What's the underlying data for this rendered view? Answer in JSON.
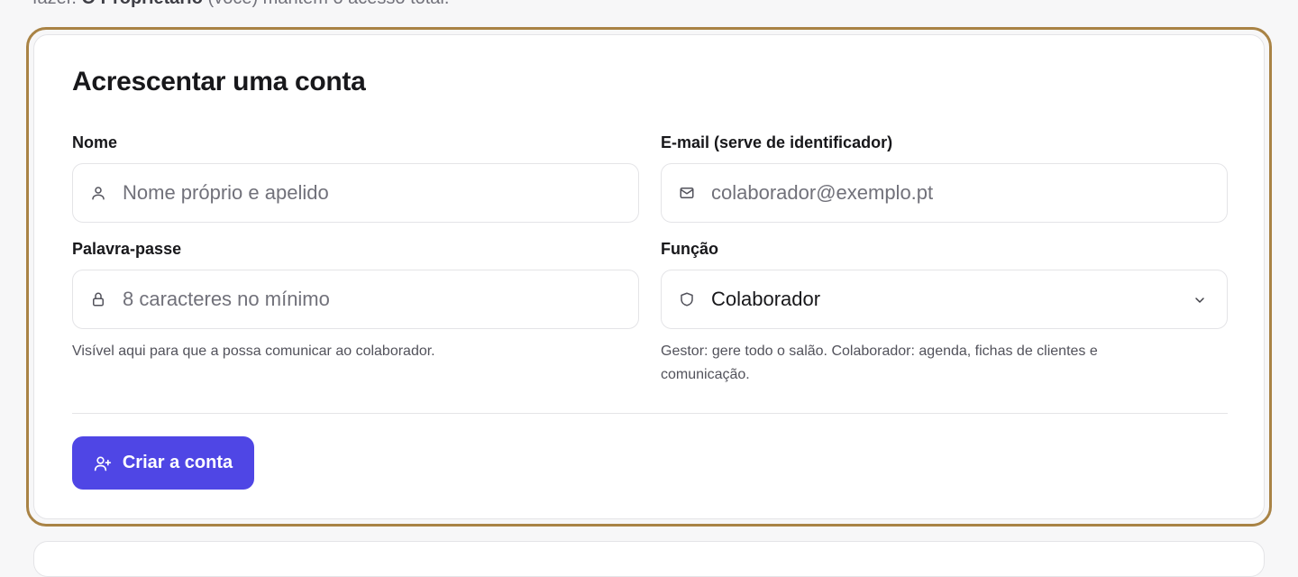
{
  "intro": {
    "prefix": "fazer.",
    "bold_role": "O Proprietário",
    "suffix": "(você) mantém o acesso total."
  },
  "form": {
    "title": "Acrescentar uma conta",
    "name": {
      "label": "Nome",
      "placeholder": "Nome próprio e apelido",
      "icon": "user-icon"
    },
    "email": {
      "label": "E-mail (serve de identificador)",
      "placeholder": "colaborador@exemplo.pt",
      "icon": "mail-icon"
    },
    "password": {
      "label": "Palavra-passe",
      "placeholder": "8 caracteres no mínimo",
      "icon": "lock-icon",
      "hint": "Visível aqui para que a possa comunicar ao colaborador."
    },
    "role": {
      "label": "Função",
      "selected": "Colaborador",
      "icon": "shield-icon",
      "hint": "Gestor: gere todo o salão. Colaborador: agenda, fichas de clientes e comunicação."
    },
    "submit_label": "Criar a conta",
    "submit_icon": "user-plus-icon"
  },
  "colors": {
    "accent": "#4f46e5",
    "focus_ring": "#a98345"
  }
}
